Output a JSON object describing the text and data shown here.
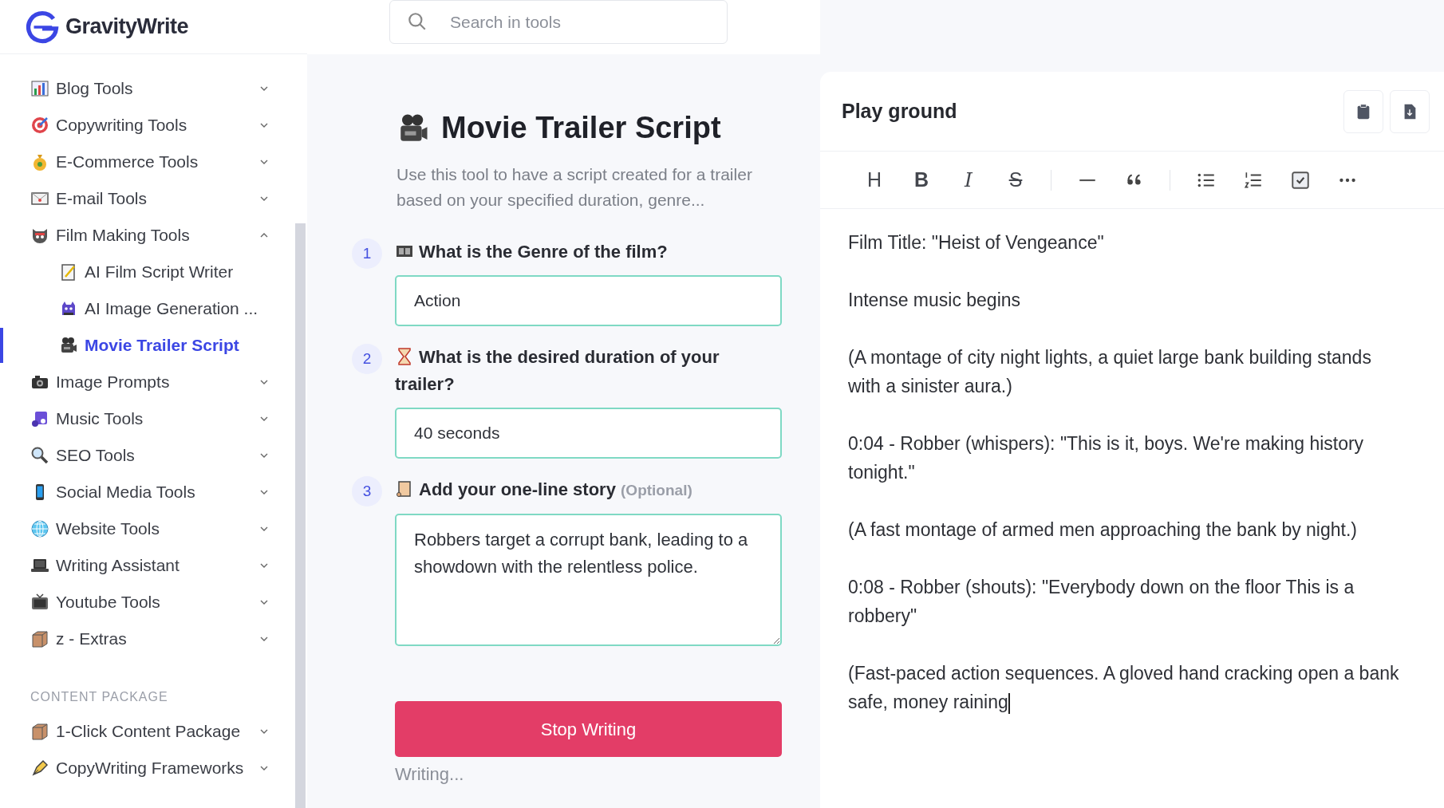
{
  "brand": {
    "name": "GravityWrite"
  },
  "sidebar": {
    "items": [
      {
        "label": "Blog Tools",
        "expanded": false
      },
      {
        "label": "Copywriting Tools",
        "expanded": false
      },
      {
        "label": "E-Commerce Tools",
        "expanded": false
      },
      {
        "label": "E-mail Tools",
        "expanded": false
      },
      {
        "label": "Film Making Tools",
        "expanded": true,
        "children": [
          {
            "label": "AI Film Script Writer",
            "selected": false
          },
          {
            "label": "AI Image Generation ...",
            "selected": false
          },
          {
            "label": "Movie Trailer Script",
            "selected": true
          }
        ]
      },
      {
        "label": "Image Prompts",
        "expanded": false
      },
      {
        "label": "Music Tools",
        "expanded": false
      },
      {
        "label": "SEO Tools",
        "expanded": false
      },
      {
        "label": "Social Media Tools",
        "expanded": false
      },
      {
        "label": "Website Tools",
        "expanded": false
      },
      {
        "label": "Writing Assistant",
        "expanded": false
      },
      {
        "label": "Youtube Tools",
        "expanded": false
      },
      {
        "label": "z - Extras",
        "expanded": false
      }
    ],
    "section": {
      "heading": "CONTENT PACKAGE",
      "items": [
        {
          "label": "1-Click Content Package",
          "expanded": false
        },
        {
          "label": "CopyWriting Frameworks",
          "expanded": false
        }
      ]
    }
  },
  "search": {
    "placeholder": "Search in tools"
  },
  "tool": {
    "title": "Movie Trailer Script",
    "description": "Use this tool to have a script created for a trailer based on your specified duration, genre...",
    "steps": [
      {
        "number": "1",
        "question": "What is the Genre of the film?",
        "kind": "input",
        "value": "Action"
      },
      {
        "number": "2",
        "question": "What is the desired duration of your trailer?",
        "kind": "input",
        "value": "40 seconds"
      },
      {
        "number": "3",
        "question": "Add your one-line story",
        "note": "(Optional)",
        "kind": "textarea",
        "value": "Robbers target a corrupt bank, leading to a showdown with the relentless police."
      }
    ],
    "button": "Stop Writing",
    "status": "Writing..."
  },
  "playground": {
    "title": "Play ground",
    "toolbar": [
      [
        {
          "kind": "text",
          "label": "H"
        },
        {
          "kind": "text",
          "label": "B"
        },
        {
          "kind": "text",
          "label": "I"
        },
        {
          "kind": "text",
          "label": "S"
        }
      ],
      [
        {
          "kind": "rule"
        },
        {
          "kind": "quote"
        }
      ],
      [
        {
          "kind": "bullets"
        },
        {
          "kind": "numbers"
        },
        {
          "kind": "task"
        },
        {
          "kind": "more"
        }
      ]
    ],
    "paragraphs": [
      "Film Title: \"Heist of Vengeance\"",
      "Intense music begins",
      "(A montage of city night lights, a quiet large bank building stands with a sinister aura.)",
      "0:04 - Robber (whispers): \"This is it, boys. We're making history tonight.\"",
      "(A fast montage of armed men approaching the bank by night.)",
      "0:08 - Robber (shouts): \"Everybody down on the floor This is a robbery\"",
      "(Fast-paced action sequences. A gloved hand cracking open a bank safe, money raining"
    ]
  }
}
